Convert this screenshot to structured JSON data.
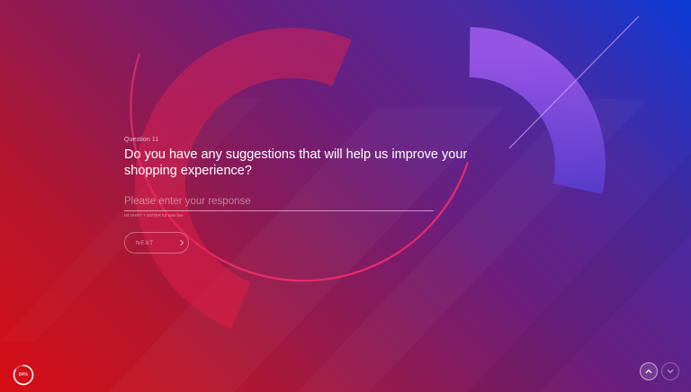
{
  "question": {
    "label": "Question 11",
    "text": "Do you have any suggestions that will help us improve your shopping experience?"
  },
  "response": {
    "placeholder": "Please enter your response",
    "value": "",
    "hint": "Hit SHIFT + ENTER for new line"
  },
  "next_button": {
    "label": "NEXT",
    "icon": "chevron-right-icon"
  },
  "progress": {
    "label": "84%",
    "value": 0.84
  },
  "navigation": {
    "up_icon": "chevron-up-icon",
    "down_icon": "chevron-down-icon"
  },
  "colors": {
    "gradient_top_right": "#0a3ad6",
    "gradient_mid": "#6a1f7e",
    "gradient_bottom_left": "#d60e14",
    "accent_pink": "#e8306a"
  }
}
